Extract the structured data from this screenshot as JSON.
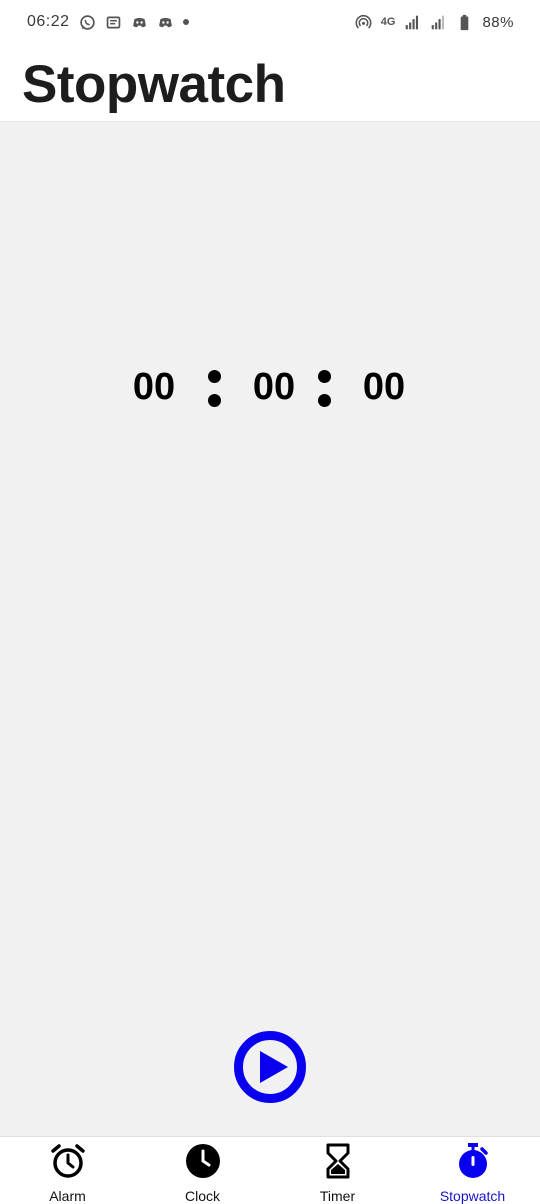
{
  "status_bar": {
    "time": "06:22",
    "network": "4G",
    "battery_percent": "88%",
    "icons": [
      "whatsapp-icon",
      "message-icon",
      "discord-icon",
      "discord-icon",
      "notification-dot",
      "hotspot-icon",
      "signal-icon",
      "signal-icon",
      "battery-icon"
    ]
  },
  "header": {
    "title": "Stopwatch"
  },
  "stopwatch": {
    "minutes": "00",
    "seconds": "00",
    "centiseconds": "00",
    "play_icon": "play-icon"
  },
  "bottom_nav": {
    "items": [
      {
        "label": "Alarm",
        "icon": "alarm-icon",
        "active": false
      },
      {
        "label": "Clock",
        "icon": "clock-icon",
        "active": false
      },
      {
        "label": "Timer",
        "icon": "hourglass-icon",
        "active": false
      },
      {
        "label": "Stopwatch",
        "icon": "stopwatch-icon",
        "active": true
      }
    ]
  },
  "colors": {
    "accent": "#0a00f0",
    "active_label": "#1a14c8",
    "background": "#f1f1f1"
  }
}
